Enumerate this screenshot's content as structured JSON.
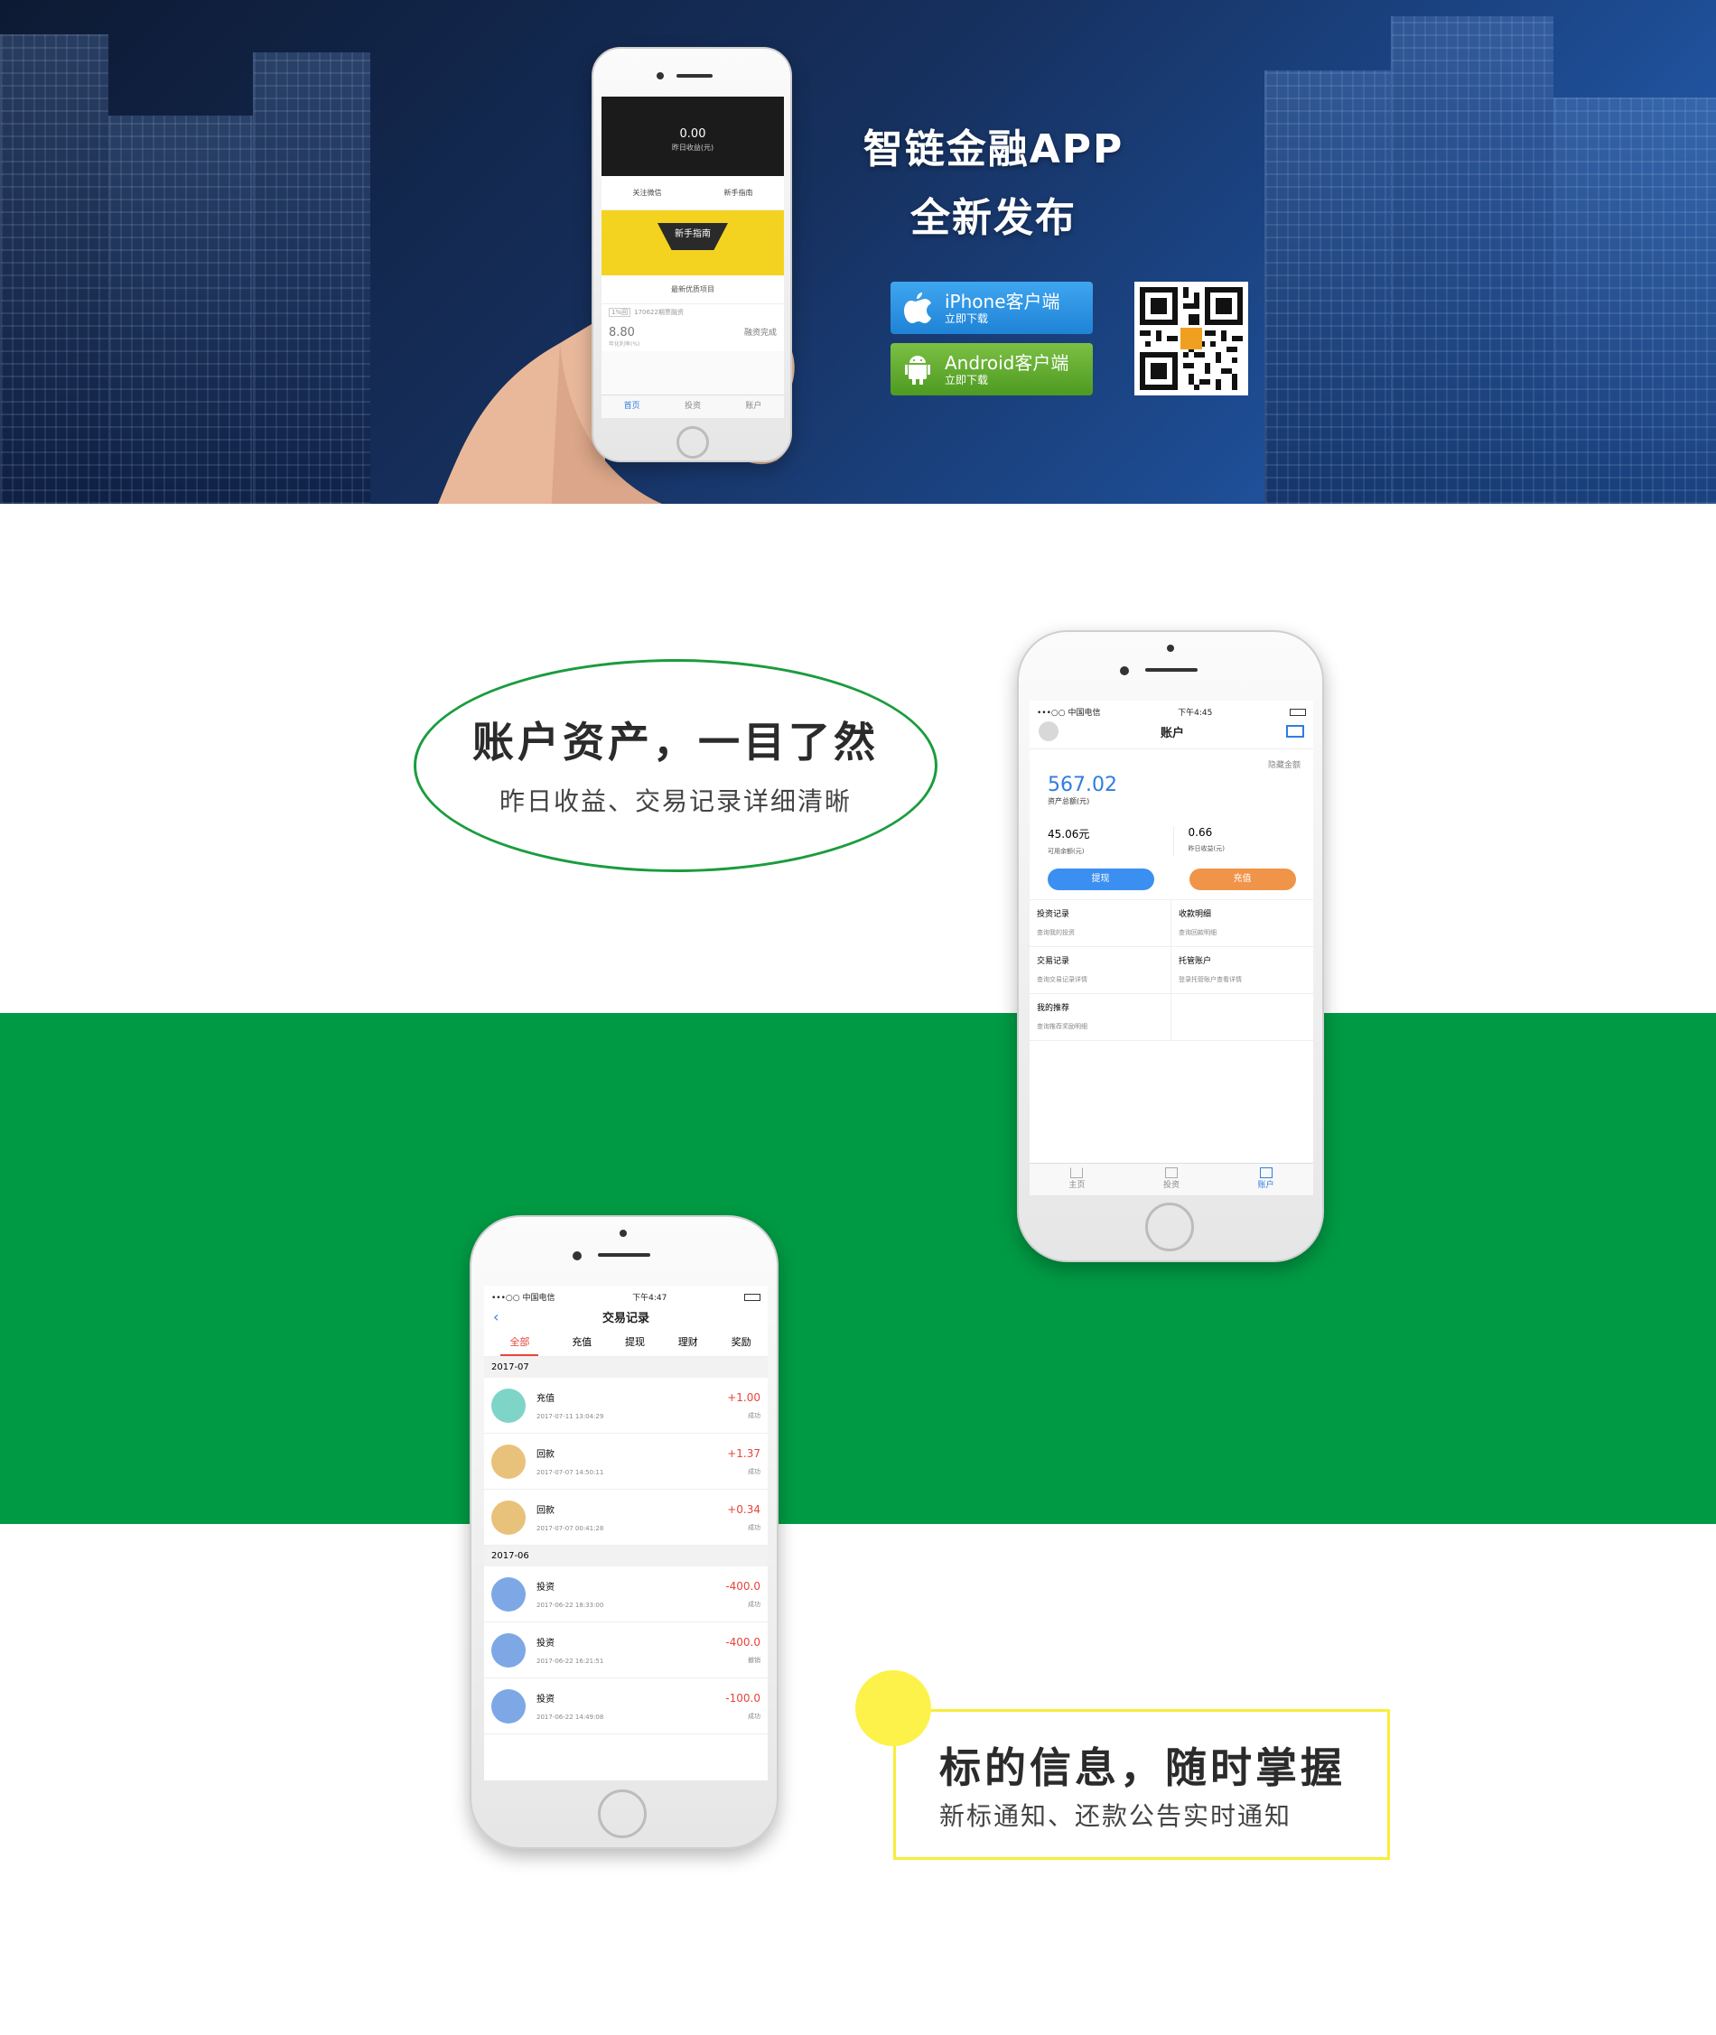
{
  "hero": {
    "title_line1": "智链金融APP",
    "title_line2": "全新发布",
    "iphone_btn": {
      "label": "iPhone客户端",
      "sub": "立即下载"
    },
    "android_btn": {
      "label": "Android客户端",
      "sub": "立即下载"
    },
    "phone_screen": {
      "yesterday_value": "0.00",
      "yesterday_label": "昨日收益(元)",
      "link_left": "关注微信",
      "link_right": "新手指南",
      "banner_text": "新手指南",
      "section_label": "最新优质项目",
      "item_tag": "1%回",
      "item_title": "170622期票融资",
      "item_rate": "8.80",
      "item_rate_label": "年化利率(%)",
      "item_status": "融资完成",
      "tabs": [
        "首页",
        "投资",
        "账户"
      ]
    }
  },
  "section2": {
    "title": "账户资产，一目了然",
    "subtitle": "昨日收益、交易记录详细清晰",
    "phone": {
      "carrier": "•••○○ 中国电信",
      "time": "下午4:45",
      "nav_title": "账户",
      "hide_amount": "隐藏金额",
      "total_value": "567.02",
      "total_label": "资产总额(元)",
      "available_value": "45.06元",
      "available_label": "可用余额(元)",
      "yesterday_value": "0.66",
      "yesterday_label": "昨日收益(元)",
      "withdraw_btn": "提现",
      "recharge_btn": "充值",
      "menu": [
        {
          "title": "投资记录",
          "desc": "查询我的投资"
        },
        {
          "title": "收款明细",
          "desc": "查询回款明细"
        },
        {
          "title": "交易记录",
          "desc": "查询交易记录详情"
        },
        {
          "title": "托管账户",
          "desc": "登录托管账户查看详情"
        },
        {
          "title": "我的推荐",
          "desc": "查询推荐奖励明细"
        }
      ],
      "tabs": [
        "主页",
        "投资",
        "账户"
      ]
    }
  },
  "section3": {
    "title": "标的信息，随时掌握",
    "subtitle": "新标通知、还款公告实时通知",
    "phone": {
      "carrier": "•••○○ 中国电信",
      "time": "下午4:47",
      "nav_title": "交易记录",
      "filters": [
        "全部",
        "充值",
        "提现",
        "理财",
        "奖励"
      ],
      "month1": "2017-07",
      "month2": "2017-06",
      "records1": [
        {
          "type": "充值",
          "date": "2017-07-11 13:04:29",
          "amount": "+1.00",
          "status": "成功"
        },
        {
          "type": "回款",
          "date": "2017-07-07 14:50:11",
          "amount": "+1.37",
          "status": "成功"
        },
        {
          "type": "回款",
          "date": "2017-07-07 00:41:28",
          "amount": "+0.34",
          "status": "成功"
        }
      ],
      "records2": [
        {
          "type": "投资",
          "date": "2017-06-22 18:33:00",
          "amount": "-400.0",
          "status": "成功"
        },
        {
          "type": "投资",
          "date": "2017-06-22 16:21:51",
          "amount": "-400.0",
          "status": "撤销"
        },
        {
          "type": "投资",
          "date": "2017-06-22 14:49:08",
          "amount": "-100.0",
          "status": "成功"
        }
      ]
    }
  },
  "colors": {
    "green": "#009a44",
    "yellow": "#fcf24a",
    "blue": "#2f7de1",
    "orange": "#f0944a",
    "red": "#e8443a"
  }
}
